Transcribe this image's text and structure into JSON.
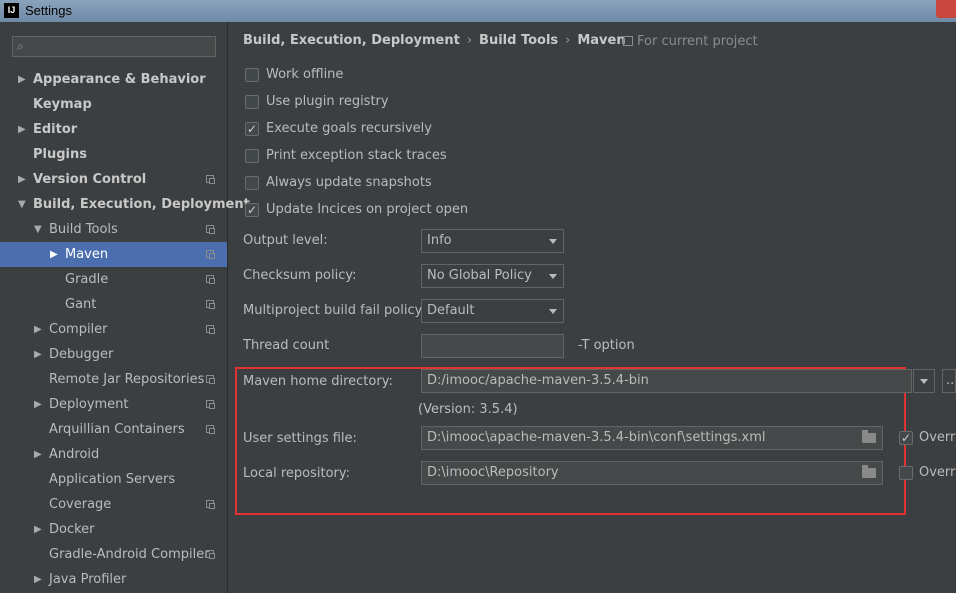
{
  "window": {
    "title": "Settings",
    "logo": "IJ"
  },
  "search": {
    "icon": "search-icon",
    "placeholder": ""
  },
  "sidebar": {
    "items": [
      {
        "label": "Appearance & Behavior",
        "arrow": "▶",
        "bold": true
      },
      {
        "label": "Keymap",
        "arrow": "",
        "bold": true
      },
      {
        "label": "Editor",
        "arrow": "▶",
        "bold": true
      },
      {
        "label": "Plugins",
        "arrow": "",
        "bold": true
      },
      {
        "label": "Version Control",
        "arrow": "▶",
        "bold": true,
        "copy": true
      },
      {
        "label": "Build, Execution, Deployment",
        "arrow": "▼",
        "bold": true
      },
      {
        "label": "Build Tools",
        "arrow": "▼",
        "copy": true
      },
      {
        "label": "Maven",
        "arrow": "▶",
        "copy": true,
        "selected": true
      },
      {
        "label": "Gradle",
        "arrow": "",
        "copy": true
      },
      {
        "label": "Gant",
        "arrow": "",
        "copy": true
      },
      {
        "label": "Compiler",
        "arrow": "▶",
        "copy": true
      },
      {
        "label": "Debugger",
        "arrow": "▶"
      },
      {
        "label": "Remote Jar Repositories",
        "arrow": "",
        "copy": true
      },
      {
        "label": "Deployment",
        "arrow": "▶",
        "copy": true
      },
      {
        "label": "Arquillian Containers",
        "arrow": "",
        "copy": true
      },
      {
        "label": "Android",
        "arrow": "▶"
      },
      {
        "label": "Application Servers",
        "arrow": ""
      },
      {
        "label": "Coverage",
        "arrow": "",
        "copy": true
      },
      {
        "label": "Docker",
        "arrow": "▶"
      },
      {
        "label": "Gradle-Android Compiler",
        "arrow": "",
        "copy": true
      },
      {
        "label": "Java Profiler",
        "arrow": "▶"
      }
    ]
  },
  "breadcrumb": {
    "parts": [
      "Build, Execution, Deployment",
      "Build Tools",
      "Maven"
    ],
    "separator": "›",
    "scope": "For current project"
  },
  "options": [
    {
      "label": "Work offline",
      "checked": false
    },
    {
      "label": "Use plugin registry",
      "checked": false
    },
    {
      "label": "Execute goals recursively",
      "checked": true
    },
    {
      "label": "Print exception stack traces",
      "checked": false
    },
    {
      "label": "Always update snapshots",
      "checked": false
    },
    {
      "label": "Update Incices on project open",
      "checked": true
    }
  ],
  "output_level": {
    "label": "Output level:",
    "value": "Info"
  },
  "checksum_policy": {
    "label": "Checksum policy:",
    "value": "No Global Policy"
  },
  "fail_policy": {
    "label": "Multiproject build fail policy:",
    "value": "Default"
  },
  "thread_count": {
    "label": "Thread count",
    "value": "",
    "suffix": "-T option"
  },
  "maven_home": {
    "label": "Maven home directory:",
    "value": "D:/imooc/apache-maven-3.5.4-bin",
    "version": "(Version: 3.5.4)",
    "more": ".."
  },
  "user_settings": {
    "label": "User settings file:",
    "value": "D:\\imooc\\apache-maven-3.5.4-bin\\conf\\settings.xml",
    "override_label": "Overri",
    "override_checked": true
  },
  "local_repo": {
    "label": "Local repository:",
    "value": "D:\\imooc\\Repository",
    "override_label": "Overri",
    "override_checked": false
  },
  "colors": {
    "selection": "#4b6eaf",
    "highlight_box": "#e03333",
    "background": "#3c3f41"
  }
}
